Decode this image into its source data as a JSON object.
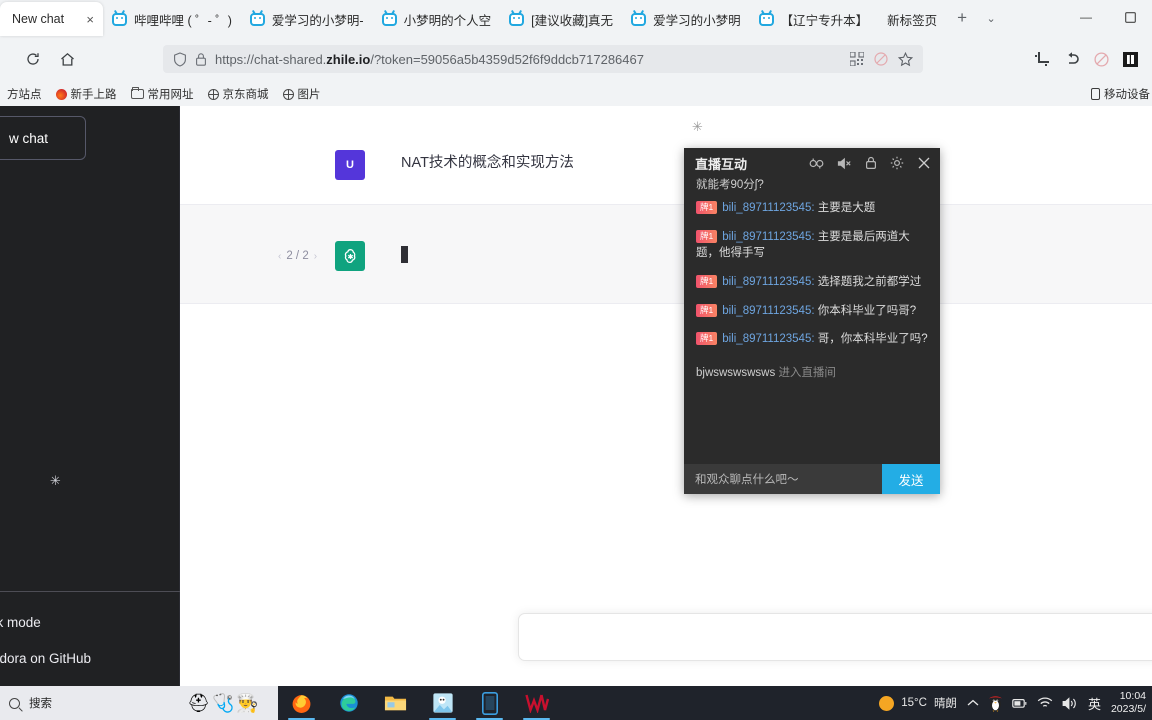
{
  "browser": {
    "tabs": [
      {
        "title": "New chat",
        "active": true,
        "favicon": "chat-favicon",
        "close": "×"
      },
      {
        "title": "哔哩哔哩 ( ゜- ゜)",
        "active": false,
        "favicon": "bilibili-favicon"
      },
      {
        "title": "爱学习的小梦明-",
        "active": false,
        "favicon": "bilibili-favicon"
      },
      {
        "title": "小梦明的个人空",
        "active": false,
        "favicon": "bilibili-favicon"
      },
      {
        "title": "[建议收藏]真无",
        "active": false,
        "favicon": "bilibili-favicon"
      },
      {
        "title": "爱学习的小梦明",
        "active": false,
        "favicon": "bilibili-favicon"
      },
      {
        "title": "【辽宁专升本】",
        "active": false,
        "favicon": "bilibili-favicon"
      }
    ],
    "new_tab_label": "新标签页",
    "new_tab_plus": "+",
    "tab_list_chevron": "⌄",
    "window_controls": {
      "minimize": "—",
      "maximize": "▫"
    },
    "nav": {
      "reload": "⟳",
      "home": "⌂",
      "shield_icon": "shield-icon",
      "lock_icon": "lock-icon"
    },
    "url": {
      "prefix": "https://chat-shared.",
      "domain": "zhile.io",
      "suffix": "/?token=59056a5b4359d52f6f9ddcb717286467",
      "full": "https://chat-shared.zhile.io/?token=59056a5b4359d52f6f9ddcb717286467"
    },
    "url_actions": [
      "qrcode-icon",
      "no-entry-icon",
      "star-icon"
    ],
    "toolbar_actions": [
      "screenshot-icon",
      "undo-icon",
      "no-entry-icon",
      "reader-icon"
    ],
    "bookmarks": [
      {
        "label": "方站点",
        "icon": "none"
      },
      {
        "label": "新手上路",
        "icon": "fire-icon"
      },
      {
        "label": "常用网址",
        "icon": "folder-icon"
      },
      {
        "label": "京东商城",
        "icon": "globe-icon"
      },
      {
        "label": "图片",
        "icon": "globe-icon"
      }
    ],
    "bookmarks_right": {
      "label": "移动设备",
      "icon": "phone-icon"
    }
  },
  "chatgpt": {
    "sidebar": {
      "new_chat": "w chat",
      "spinner": "✳",
      "bottom_items": [
        {
          "label": "rk mode"
        },
        {
          "label": "ndora on GitHub"
        }
      ]
    },
    "main": {
      "spinner": "✳",
      "user_message": {
        "avatar": "U",
        "text": "NAT技术的概念和实现方法"
      },
      "bot_message": {
        "avatar": "gpt-logo",
        "text": "",
        "caret": true
      },
      "pager": {
        "prev": "‹",
        "value": "2 / 2",
        "next": "›"
      },
      "composer_placeholder": ""
    }
  },
  "live_panel": {
    "title": "直播互动",
    "header_icons": [
      "emoji-69-icon",
      "mute-icon",
      "lock-icon",
      "gear-icon",
      "close-icon"
    ],
    "subtitle": "就能考90分ʃ?",
    "messages": [
      {
        "badge": "牌1",
        "user": "bili_89711123545:",
        "text": "主要是大题"
      },
      {
        "badge": "牌1",
        "user": "bili_89711123545:",
        "text": "主要是最后两道大题，他得手写"
      },
      {
        "badge": "牌1",
        "user": "bili_89711123545:",
        "text": "选择题我之前都学过"
      },
      {
        "badge": "牌1",
        "user": "bili_89711123545:",
        "text": "你本科毕业了吗哥?"
      },
      {
        "badge": "牌1",
        "user": "bili_89711123545:",
        "text": "哥，你本科毕业了吗?"
      }
    ],
    "enter_notice": {
      "name": "bjwswswswsws",
      "text": "进入直播间"
    },
    "input_placeholder": "和观众聊点什么吧～",
    "send_label": "发送"
  },
  "taskbar": {
    "search_placeholder": "搜索",
    "search_icon": "search-icon",
    "widget_emojis": [
      "⛑",
      "🩺",
      "👨‍🍳"
    ],
    "apps": [
      {
        "name": "firefox-icon",
        "running": true
      },
      {
        "name": "edge-icon",
        "running": false
      },
      {
        "name": "file-explorer-icon",
        "running": false
      },
      {
        "name": "photos-icon",
        "running": true
      },
      {
        "name": "phone-link-icon",
        "running": true
      },
      {
        "name": "wps-icon",
        "running": true
      }
    ],
    "weather": {
      "temperature": "15°C",
      "condition": "晴朗",
      "icon": "sun-icon"
    },
    "tray": [
      "chevron-up-icon",
      "penguin-icon",
      "battery-icon",
      "wifi-icon",
      "volume-icon"
    ],
    "ime": "英",
    "clock": {
      "time": "10:04",
      "date": "2023/5/"
    }
  },
  "colors": {
    "chrome_bg": "#f1f3f5",
    "sidebar_bg": "#202123",
    "gpt_green": "#10a37f",
    "user_purple": "#5436da",
    "bili_blue": "#23ade5",
    "taskbar_bg": "#1f232b",
    "highlight_yellow": "#f4f0a7"
  }
}
